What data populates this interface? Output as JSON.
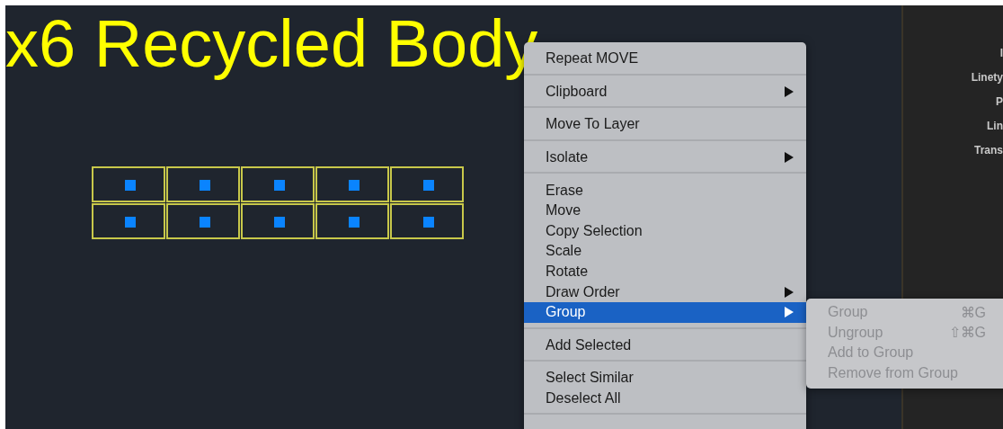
{
  "canvas": {
    "title": "x6 Recycled Body"
  },
  "context_menu": {
    "sections": [
      [
        {
          "label": "Repeat MOVE",
          "submenu": false,
          "selected": false
        }
      ],
      [
        {
          "label": "Clipboard",
          "submenu": true,
          "selected": false
        }
      ],
      [
        {
          "label": "Move To Layer",
          "submenu": false,
          "selected": false
        }
      ],
      [
        {
          "label": "Isolate",
          "submenu": true,
          "selected": false
        }
      ],
      [
        {
          "label": "Erase",
          "submenu": false,
          "selected": false
        },
        {
          "label": "Move",
          "submenu": false,
          "selected": false
        },
        {
          "label": "Copy Selection",
          "submenu": false,
          "selected": false
        },
        {
          "label": "Scale",
          "submenu": false,
          "selected": false
        },
        {
          "label": "Rotate",
          "submenu": false,
          "selected": false
        },
        {
          "label": "Draw Order",
          "submenu": true,
          "selected": false
        },
        {
          "label": "Group",
          "submenu": true,
          "selected": true
        }
      ],
      [
        {
          "label": "Add Selected",
          "submenu": false,
          "selected": false
        }
      ],
      [
        {
          "label": "Select Similar",
          "submenu": false,
          "selected": false
        },
        {
          "label": "Deselect All",
          "submenu": false,
          "selected": false
        }
      ]
    ]
  },
  "submenu": {
    "items": [
      {
        "label": "Group",
        "shortcut": "⌘G",
        "disabled": true
      },
      {
        "label": "Ungroup",
        "shortcut": "⇧⌘G",
        "disabled": true
      },
      {
        "label": "Add to Group",
        "disabled": true
      },
      {
        "label": "Remove from Group",
        "disabled": true
      }
    ]
  },
  "properties_panel": {
    "labels": [
      "I",
      "Linety",
      "P",
      "Lin",
      "Trans"
    ]
  }
}
